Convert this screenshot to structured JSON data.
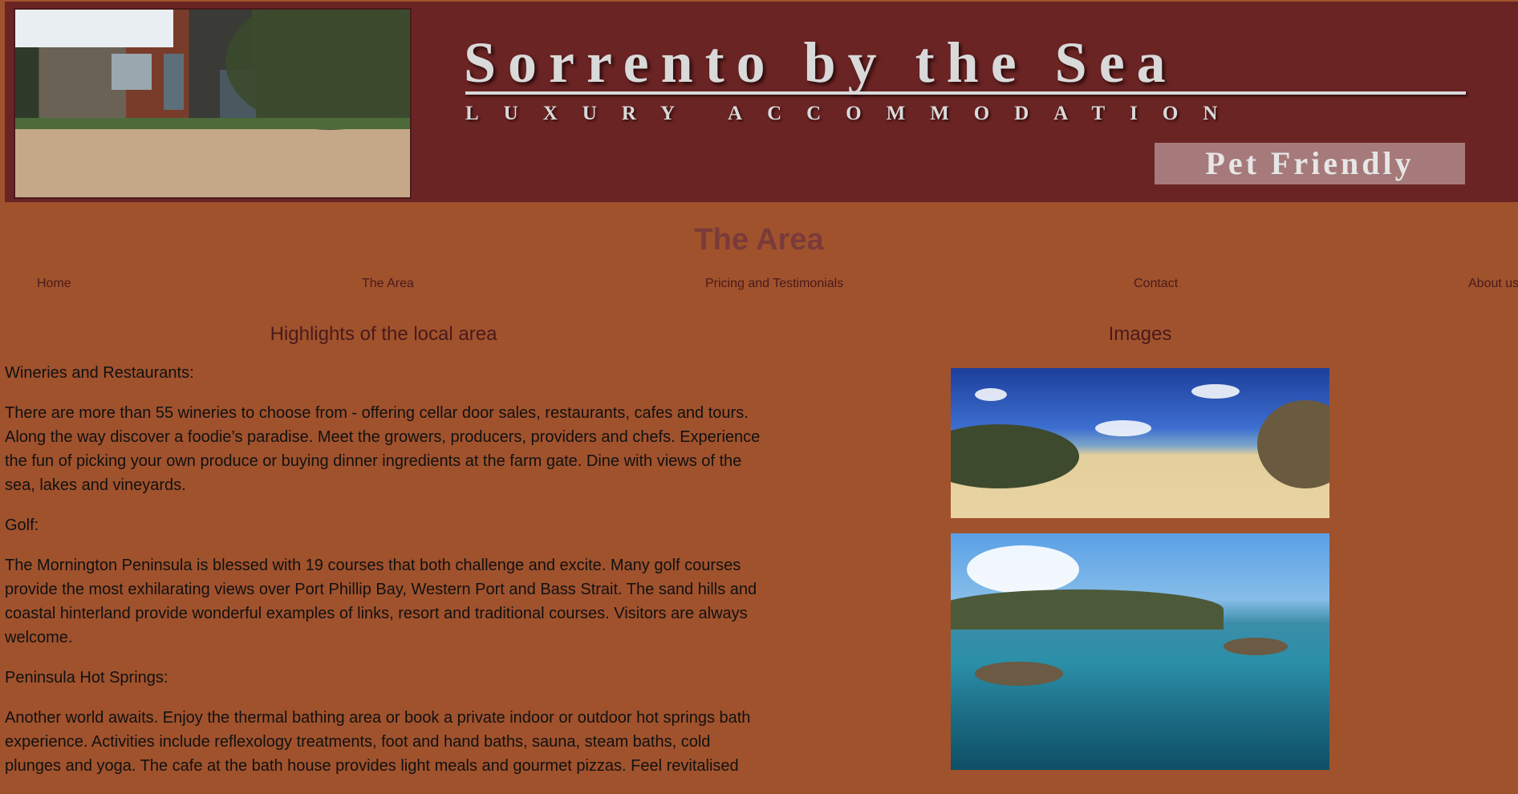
{
  "banner": {
    "title": "Sorrento by the Sea",
    "subtitle": "LUXURY ACCOMMODATION",
    "badge": "Pet Friendly"
  },
  "page_title": "The Area",
  "nav": {
    "items": [
      {
        "label": "Home"
      },
      {
        "label": "The Area"
      },
      {
        "label": "Pricing and Testimonials"
      },
      {
        "label": "Contact"
      },
      {
        "label": "About us"
      }
    ]
  },
  "main": {
    "left_heading": "Highlights of the local area",
    "right_heading": "Images",
    "sections": [
      {
        "heading": "Wineries and Restaurants:",
        "body": "There are more than 55 wineries to choose from - offering cellar door sales, restaurants, cafes and tours. Along the way discover a foodie’s paradise. Meet the growers, producers, providers and chefs. Experience the fun of picking your own produce or buying dinner ingredients at the farm gate. Dine with views of the sea, lakes and vineyards."
      },
      {
        "heading": "Golf:",
        "body": "The Mornington Peninsula is blessed with 19 courses that both challenge and excite. Many golf courses provide the most exhilarating views over Port Phillip Bay, Western Port and Bass Strait. The sand hills and coastal hinterland provide wonderful examples of links, resort and traditional courses. Visitors are always welcome."
      },
      {
        "heading": "Peninsula Hot Springs:",
        "body": "Another world awaits. Enjoy the thermal bathing area or book a private indoor or outdoor hot springs bath experience. Activities include reflexology treatments, foot and hand baths, sauna, steam baths, cold plunges and yoga. The cafe at the bath house provides light meals and gourmet pizzas. Feel revitalised"
      }
    ]
  },
  "colors": {
    "page_bg": "#a0522d",
    "banner_bg": "#6b2424",
    "title_color": "#7b3a3a"
  }
}
